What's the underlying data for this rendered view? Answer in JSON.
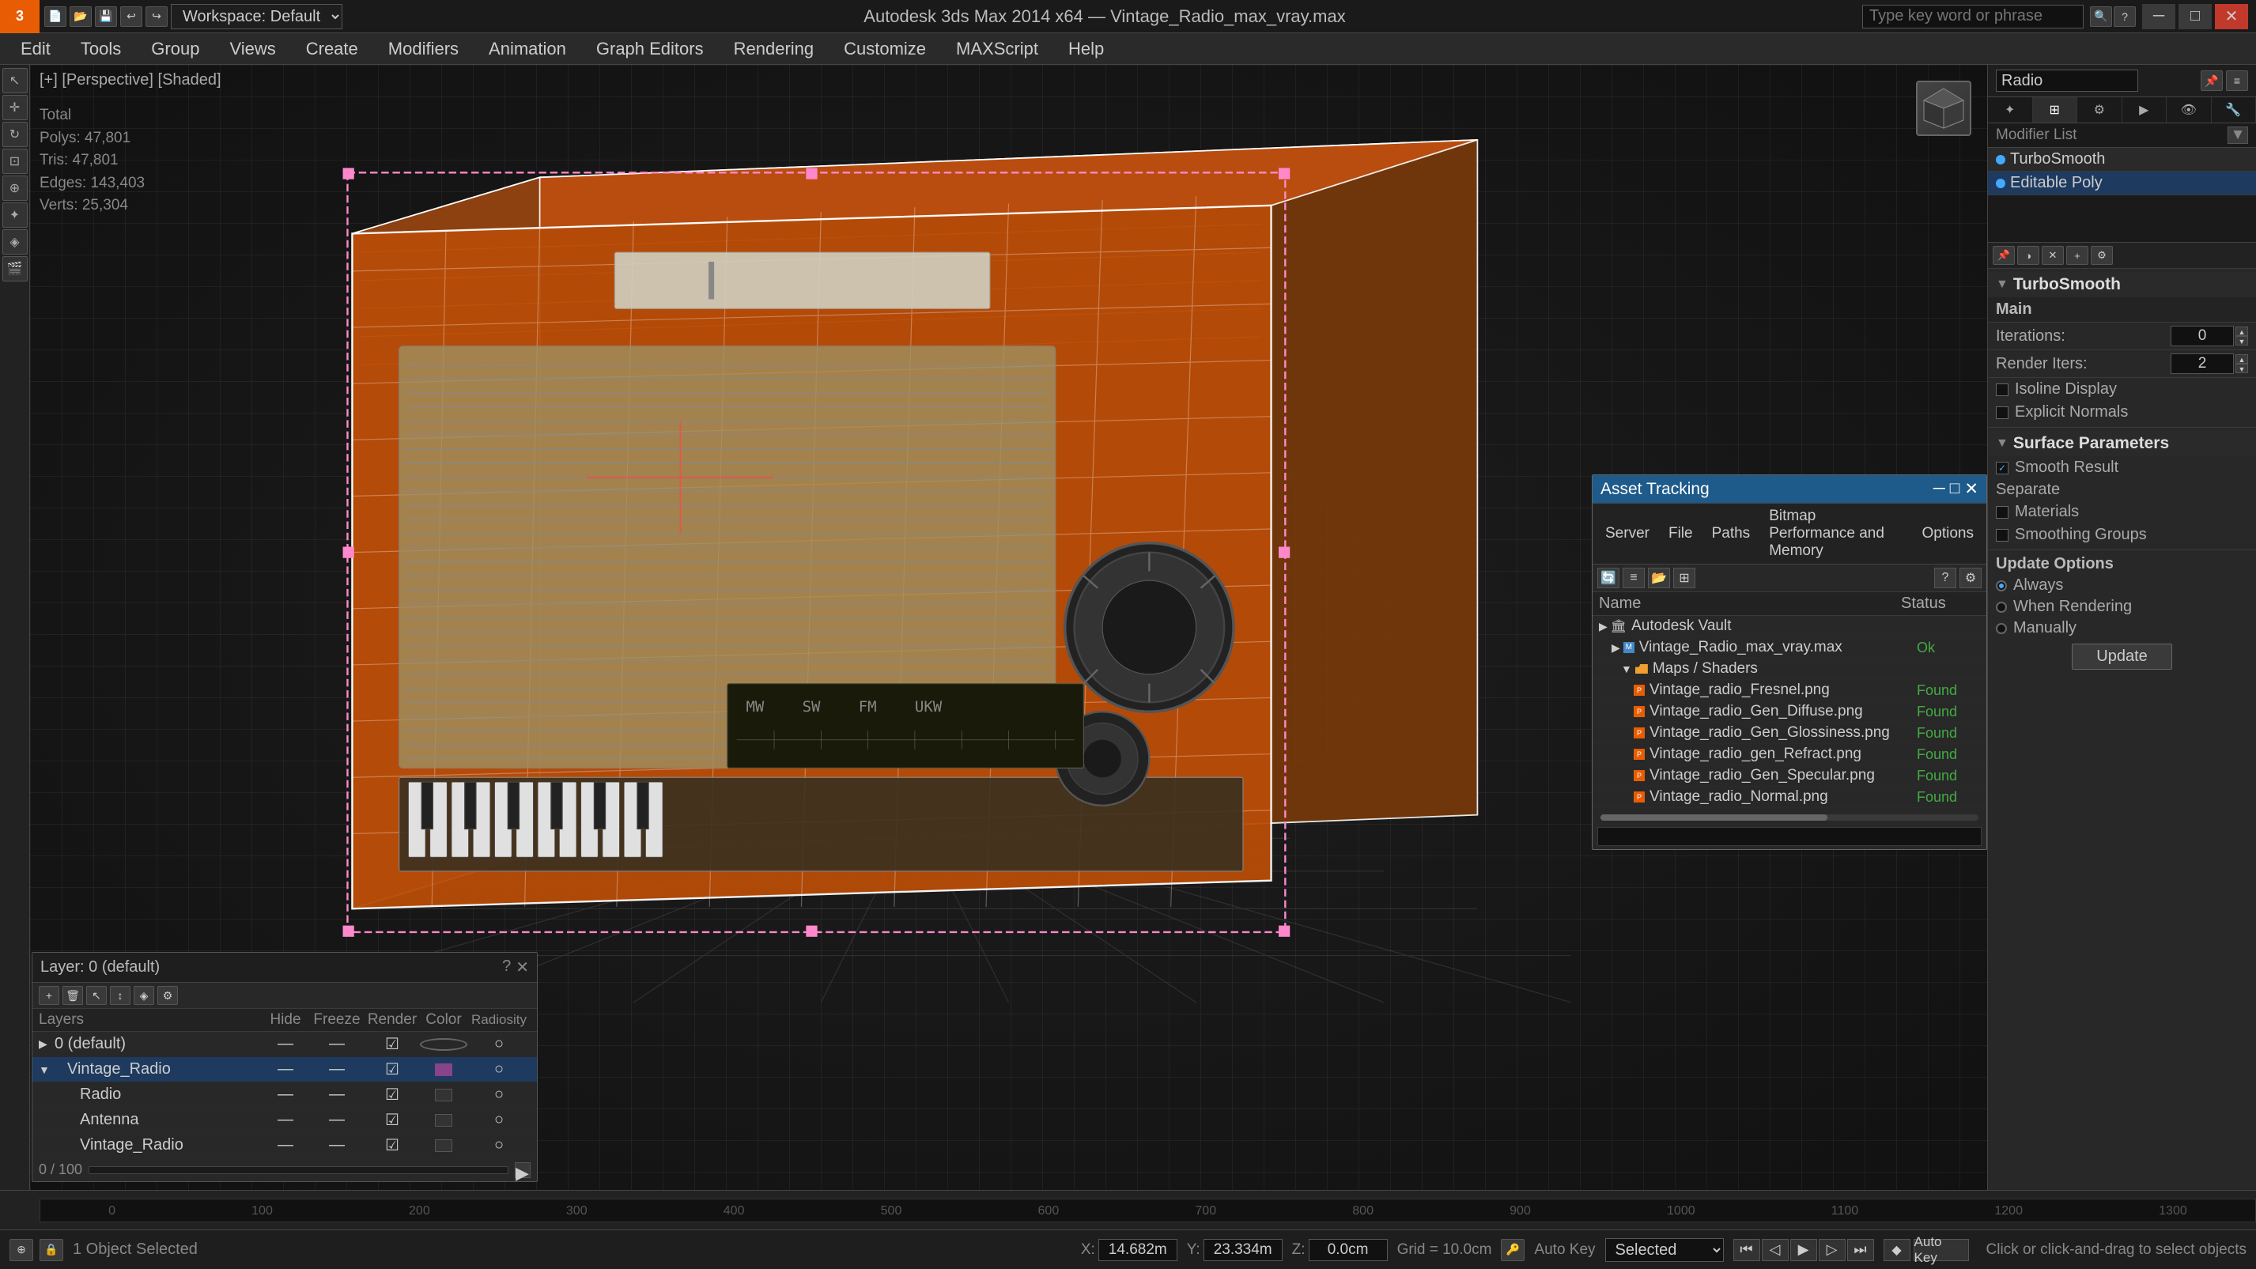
{
  "app": {
    "title": "Autodesk 3ds Max 2014 x64",
    "file": "Vintage_Radio_max_vray.max",
    "logo": "3",
    "workspace": "Workspace: Default"
  },
  "menubar": {
    "items": [
      "Edit",
      "Tools",
      "Group",
      "Views",
      "Create",
      "Modifiers",
      "Animation",
      "Graph Editors",
      "Rendering",
      "Customize",
      "MAXScript",
      "Help"
    ]
  },
  "search": {
    "placeholder": "Type key word or phrase"
  },
  "viewport": {
    "label": "[+] [Perspective] [Shaded]",
    "stats": {
      "total": "Total",
      "polys": "47,801",
      "tris": "47,801",
      "edges": "143,403",
      "verts": "25,304"
    }
  },
  "right_panel": {
    "object_name": "Radio",
    "modifier_list_label": "Modifier List",
    "modifiers": [
      "TurboSmooth",
      "Editable Poly"
    ],
    "turbosmooth": {
      "section": "TurboSmooth",
      "main_label": "Main",
      "iterations_label": "Iterations:",
      "iterations_val": "0",
      "render_iters_label": "Render Iters:",
      "render_iters_val": "2",
      "isoline_display": "Isoline Display",
      "explicit_normals": "Explicit Normals",
      "surface_params_label": "Surface Parameters",
      "smooth_result": "Smooth Result",
      "separate_label": "Separate",
      "materials": "Materials",
      "smoothing_groups": "Smoothing Groups",
      "update_options_label": "Update Options",
      "always": "Always",
      "when_rendering": "When Rendering",
      "manually": "Manually",
      "update_btn": "Update"
    }
  },
  "layers_panel": {
    "title": "Layer: 0 (default)",
    "columns": [
      "Layers",
      "Hide",
      "Freeze",
      "Render",
      "Color",
      "Radiosity"
    ],
    "layers": [
      {
        "name": "0 (default)",
        "indent": 0,
        "selected": false
      },
      {
        "name": "Vintage_Radio",
        "indent": 1,
        "selected": true
      },
      {
        "name": "Radio",
        "indent": 2,
        "selected": false
      },
      {
        "name": "Antenna",
        "indent": 2,
        "selected": false
      },
      {
        "name": "Vintage_Radio",
        "indent": 2,
        "selected": false
      }
    ]
  },
  "asset_tracking": {
    "title": "Asset Tracking",
    "menu": [
      "Server",
      "File",
      "Paths",
      "Bitmap Performance and Memory",
      "Options"
    ],
    "columns": [
      "Name",
      "Status"
    ],
    "rows": [
      {
        "name": "Autodesk Vault",
        "indent": 0,
        "status": "",
        "type": "folder"
      },
      {
        "name": "Vintage_Radio_max_vray.max",
        "indent": 1,
        "status": "Ok",
        "type": "file"
      },
      {
        "name": "Maps / Shaders",
        "indent": 2,
        "status": "",
        "type": "folder"
      },
      {
        "name": "Vintage_radio_Fresnel.png",
        "indent": 3,
        "status": "Found",
        "type": "map"
      },
      {
        "name": "Vintage_radio_Gen_Diffuse.png",
        "indent": 3,
        "status": "Found",
        "type": "map"
      },
      {
        "name": "Vintage_radio_Gen_Glossiness.png",
        "indent": 3,
        "status": "Found",
        "type": "map"
      },
      {
        "name": "Vintage_radio_gen_Refract.png",
        "indent": 3,
        "status": "Found",
        "type": "map"
      },
      {
        "name": "Vintage_radio_Gen_Specular.png",
        "indent": 3,
        "status": "Found",
        "type": "map"
      },
      {
        "name": "Vintage_radio_Normal.png",
        "indent": 3,
        "status": "Found",
        "type": "map"
      }
    ]
  },
  "timeline": {
    "labels": [
      "0",
      "100"
    ],
    "ticks": [
      "0",
      "100",
      "200",
      "300",
      "400",
      "500",
      "600",
      "700",
      "800",
      "900",
      "1000",
      "1100",
      "1200",
      "1300"
    ]
  },
  "bottom_status": {
    "objects_selected": "1 Object Selected",
    "hint": "Click or click-and-drag to select objects",
    "x": "14.682m",
    "y": "23.334m",
    "z": "0.0cm",
    "grid": "Grid = 10.0cm",
    "autokey": "Auto Key",
    "selected_label": "Selected"
  },
  "icons": {
    "minimize": "─",
    "maximize": "□",
    "close": "✕",
    "play": "▶",
    "stop": "■",
    "prev": "⏮",
    "next": "⏭",
    "key": "◆"
  }
}
